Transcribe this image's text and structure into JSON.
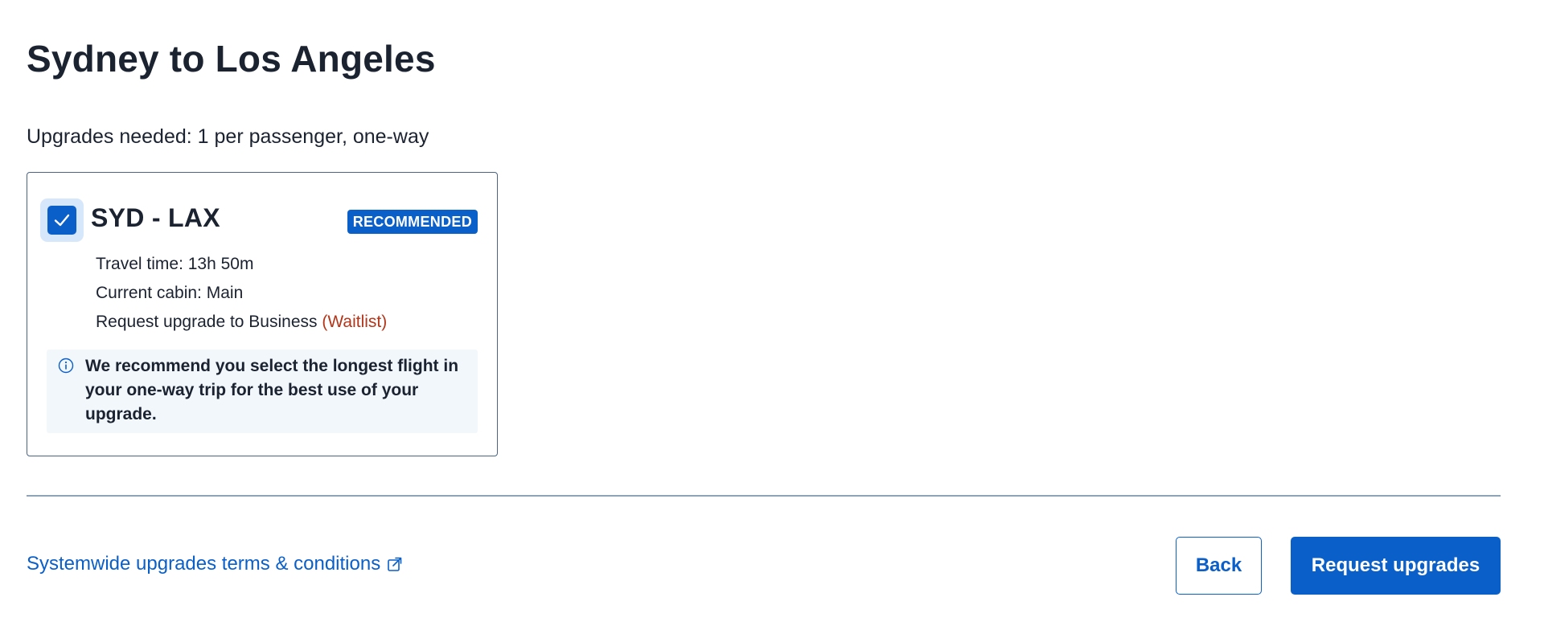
{
  "page": {
    "title": "Sydney to Los Angeles",
    "upgrades_needed": "Upgrades needed: 1 per passenger, one-way"
  },
  "segment": {
    "checked": true,
    "route": "SYD - LAX",
    "badge": "RECOMMENDED",
    "travel_time": "Travel time: 13h 50m",
    "current_cabin": "Current cabin: Main",
    "upgrade_request": "Request upgrade to Business",
    "upgrade_status": "(Waitlist)",
    "info_icon": "info-icon",
    "info_message": "We recommend you select the longest flight in your one-way trip for the best use of your upgrade."
  },
  "footer": {
    "terms_link": "Systemwide upgrades terms & conditions",
    "terms_icon": "external-link-icon",
    "back_label": "Back",
    "request_label": "Request upgrades"
  },
  "colors": {
    "accent": "#0a5fc9",
    "waitlist": "#b3361a",
    "text": "#1b2230",
    "info_bg": "#f2f7fc"
  }
}
